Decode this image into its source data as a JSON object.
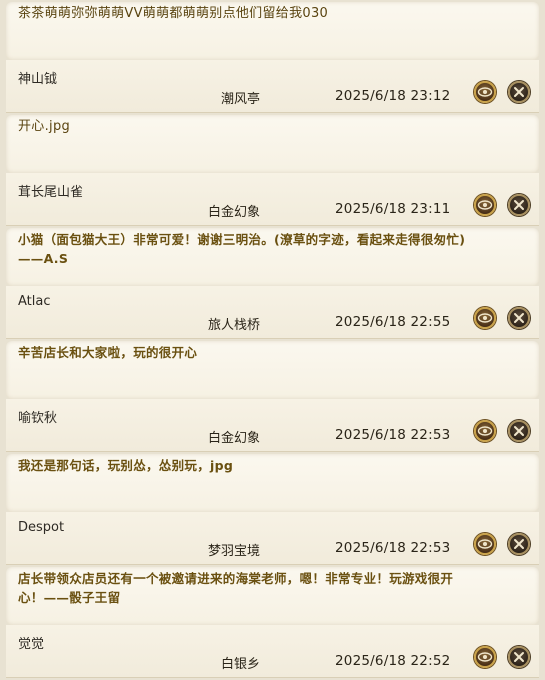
{
  "entries": [
    {
      "message": "茶茶萌萌弥弥萌萌VV萌萌都萌萌别点他们留给我030",
      "author": "神山钺",
      "server": "潮风亭",
      "time": "2025/6/18 23:12"
    },
    {
      "message": "开心.jpg",
      "author": "茸长尾山雀",
      "server": "白金幻象",
      "time": "2025/6/18 23:11"
    },
    {
      "message": "小猫（面包猫大王）非常可爱！谢谢三明治。(潦草的字迹，看起来走得很匆忙)——A.S",
      "author": "Atlac",
      "server": "旅人栈桥",
      "time": "2025/6/18 22:55"
    },
    {
      "message": "辛苦店长和大家啦，玩的很开心",
      "author": "喻钦秋",
      "server": "白金幻象",
      "time": "2025/6/18 22:53"
    },
    {
      "message": "我还是那句话，玩别怂，怂别玩，jpg",
      "author": "Despot",
      "server": "梦羽宝境",
      "time": "2025/6/18 22:53"
    },
    {
      "message": "店长带领众店员还有一个被邀请进来的海棠老师，嗯！非常专业！玩游戏很开心！——骰子王留",
      "author": "觉觉",
      "server": "白银乡",
      "time": "2025/6/18 22:52"
    }
  ],
  "icons": {
    "view": "eye-icon",
    "delete": "close-icon"
  },
  "colors": {
    "message_text": "#6a5010",
    "button_ring": "#c9a24a",
    "background": "#efe9da"
  }
}
